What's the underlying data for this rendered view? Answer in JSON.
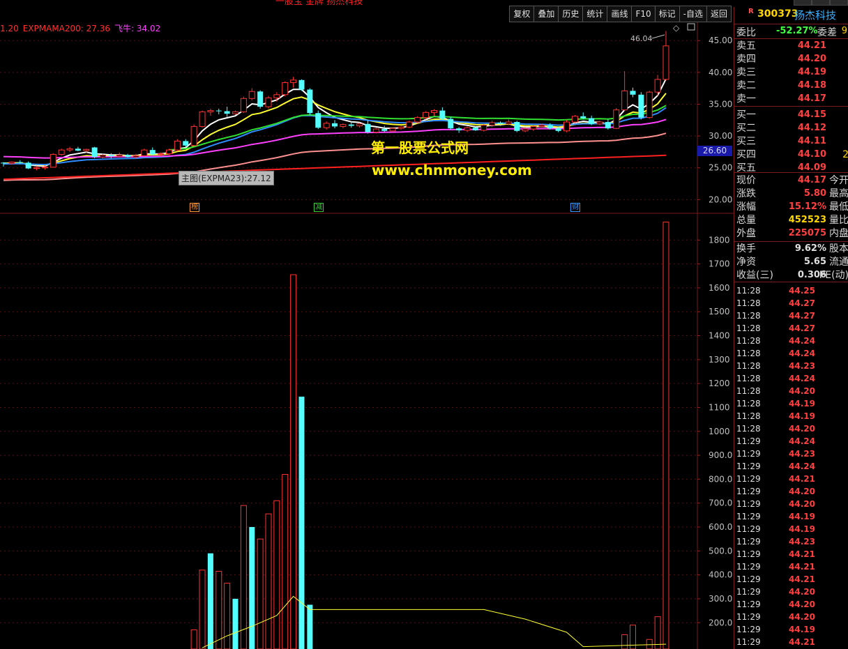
{
  "window": {
    "title": "一股宝 金牌 扬杰科技",
    "toolbar": [
      "复权",
      "叠加",
      "历史",
      "统计",
      "画线",
      "F10",
      "标记",
      "-自选",
      "返回"
    ]
  },
  "indicator_bar": {
    "items": [
      {
        "text": "1.20",
        "color": "#ff3030"
      },
      {
        "text": "EXPMAMA200: 27.36",
        "color": "#ff3030"
      },
      {
        "text": "飞牛: 34.02",
        "color": "#ff40ff"
      }
    ]
  },
  "watermark": {
    "line1": "第一股票公式网",
    "line2": "www.chnmoney.com"
  },
  "tooltip": "主图(EXPMA23):27.12",
  "price_badge": "26.60",
  "high_label": "46.04",
  "markers": [
    {
      "text": "榜",
      "color": "#ff9933"
    },
    {
      "text": "减",
      "color": "#33cc33"
    },
    {
      "text": "财",
      "color": "#3399ff"
    }
  ],
  "chart_data": [
    {
      "type": "candlestick",
      "title": "",
      "ylim": [
        18.5,
        47
      ],
      "y_ticks": [
        "45.00",
        "40.00",
        "35.00",
        "30.00",
        "25.00",
        "20.00"
      ],
      "y_tick_values": [
        45,
        40,
        35,
        30,
        25,
        20
      ],
      "candles": [
        [
          25.8,
          25.9,
          25.2,
          25.7
        ],
        [
          25.7,
          26.0,
          25.5,
          25.9
        ],
        [
          25.9,
          26.2,
          25.6,
          25.8
        ],
        [
          25.8,
          26.0,
          24.8,
          24.9
        ],
        [
          24.9,
          25.3,
          24.6,
          25.0
        ],
        [
          25.0,
          25.4,
          24.7,
          25.1
        ],
        [
          25.1,
          27.3,
          25.0,
          27.1
        ],
        [
          27.1,
          28.0,
          26.9,
          27.8
        ],
        [
          27.8,
          28.3,
          27.5,
          28.0
        ],
        [
          28.0,
          28.3,
          27.6,
          27.7
        ],
        [
          27.7,
          28.0,
          27.3,
          27.9
        ],
        [
          28.2,
          28.3,
          26.5,
          26.7
        ],
        [
          26.7,
          27.2,
          26.5,
          27.0
        ],
        [
          27.0,
          27.3,
          26.5,
          26.8
        ],
        [
          26.8,
          27.4,
          26.6,
          27.0
        ],
        [
          27.0,
          27.2,
          26.6,
          26.7
        ],
        [
          26.7,
          27.2,
          26.4,
          26.9
        ],
        [
          26.9,
          28.0,
          26.8,
          27.8
        ],
        [
          27.8,
          28.2,
          27.0,
          27.1
        ],
        [
          27.1,
          27.4,
          26.8,
          27.2
        ],
        [
          27.2,
          28.0,
          27.0,
          27.8
        ],
        [
          27.8,
          29.5,
          27.6,
          29.2
        ],
        [
          29.2,
          29.5,
          28.3,
          28.5
        ],
        [
          28.5,
          31.8,
          28.4,
          31.5
        ],
        [
          31.5,
          34.0,
          31.3,
          33.8
        ],
        [
          33.8,
          34.3,
          33.2,
          34.0
        ],
        [
          34.0,
          34.3,
          33.4,
          33.9
        ],
        [
          33.9,
          34.6,
          33.0,
          33.5
        ],
        [
          33.5,
          34.0,
          33.3,
          33.8
        ],
        [
          33.8,
          36.2,
          33.6,
          35.9
        ],
        [
          35.9,
          37.5,
          35.6,
          37.0
        ],
        [
          37.0,
          37.2,
          34.3,
          34.6
        ],
        [
          34.6,
          36.3,
          34.3,
          36.0
        ],
        [
          36.0,
          36.9,
          35.4,
          36.5
        ],
        [
          36.5,
          38.6,
          36.2,
          38.4
        ],
        [
          38.4,
          39.3,
          37.6,
          38.8
        ],
        [
          38.8,
          38.9,
          37.1,
          37.3
        ],
        [
          37.3,
          37.5,
          33.3,
          33.6
        ],
        [
          33.6,
          34.0,
          31.1,
          31.3
        ],
        [
          31.3,
          32.3,
          31.0,
          32.0
        ],
        [
          32.0,
          32.5,
          31.2,
          31.5
        ],
        [
          31.5,
          32.0,
          31.2,
          31.8
        ],
        [
          31.8,
          32.3,
          31.3,
          31.6
        ],
        [
          31.6,
          32.1,
          31.3,
          31.9
        ],
        [
          31.9,
          32.5,
          30.4,
          30.6
        ],
        [
          30.6,
          31.3,
          30.4,
          31.1
        ],
        [
          31.1,
          31.6,
          30.6,
          30.8
        ],
        [
          30.8,
          31.4,
          30.6,
          31.2
        ],
        [
          31.2,
          31.6,
          31.0,
          31.4
        ],
        [
          31.4,
          32.4,
          31.2,
          32.2
        ],
        [
          32.2,
          33.1,
          32.0,
          32.9
        ],
        [
          32.9,
          33.9,
          32.6,
          33.7
        ],
        [
          33.7,
          34.2,
          33.2,
          34.0
        ],
        [
          34.0,
          34.5,
          32.5,
          32.7
        ],
        [
          32.7,
          33.0,
          31.0,
          31.2
        ],
        [
          31.2,
          31.4,
          30.5,
          30.9
        ],
        [
          30.9,
          31.5,
          30.6,
          31.3
        ],
        [
          31.3,
          31.5,
          30.8,
          30.9
        ],
        [
          30.9,
          31.9,
          30.7,
          31.7
        ],
        [
          31.7,
          32.4,
          31.4,
          32.1
        ],
        [
          32.1,
          32.3,
          31.6,
          31.9
        ],
        [
          31.9,
          32.6,
          31.7,
          32.2
        ],
        [
          32.2,
          32.4,
          30.6,
          30.8
        ],
        [
          30.8,
          31.4,
          30.6,
          31.1
        ],
        [
          31.1,
          31.6,
          30.8,
          31.5
        ],
        [
          31.5,
          31.9,
          31.3,
          31.7
        ],
        [
          31.7,
          32.0,
          31.0,
          31.2
        ],
        [
          31.2,
          31.4,
          30.6,
          30.8
        ],
        [
          30.8,
          32.5,
          30.6,
          32.2
        ],
        [
          32.2,
          33.3,
          32.0,
          33.1
        ],
        [
          33.1,
          33.7,
          32.6,
          32.8
        ],
        [
          32.8,
          33.2,
          31.7,
          31.9
        ],
        [
          31.9,
          32.4,
          31.7,
          32.2
        ],
        [
          32.2,
          32.6,
          31.0,
          31.2
        ],
        [
          31.2,
          34.4,
          31.1,
          34.1
        ],
        [
          34.1,
          40.2,
          33.9,
          37.1
        ],
        [
          37.1,
          37.6,
          36.1,
          36.5
        ],
        [
          36.5,
          36.9,
          32.6,
          32.9
        ],
        [
          32.9,
          37.1,
          32.7,
          36.9
        ],
        [
          36.9,
          39.6,
          36.3,
          38.9
        ],
        [
          38.9,
          46.5,
          38.7,
          44.17
        ]
      ],
      "ma_lines": [
        {
          "name": "",
          "color": "#ffffff",
          "values": []
        },
        {
          "name": "",
          "color": "#ffff30",
          "values": []
        },
        {
          "name": "",
          "color": "#2f8cff",
          "values": []
        },
        {
          "name": "",
          "color": "#ff40ff",
          "values": []
        },
        {
          "name": "",
          "color": "#30e030",
          "values": []
        },
        {
          "name": "",
          "color": "#ff9090",
          "values": []
        },
        {
          "name": "",
          "color": "#ff2020",
          "values": []
        }
      ]
    },
    {
      "type": "bar",
      "title": "",
      "ylim": [
        90,
        1900
      ],
      "y_ticks": [
        "1800",
        "1700",
        "1600",
        "1500",
        "1400",
        "1300",
        "1200",
        "1100",
        "1000",
        "900.0",
        "800.0",
        "700.0",
        "600.0",
        "500.0",
        "400.0",
        "300.0",
        "200.0"
      ],
      "y_tick_values": [
        1800,
        1700,
        1600,
        1500,
        1400,
        1300,
        1200,
        1100,
        1000,
        900,
        800,
        700,
        600,
        500,
        400,
        300,
        200
      ],
      "bars": [
        {
          "i": 23,
          "value": 170,
          "up": true
        },
        {
          "i": 24,
          "value": 420,
          "up": true
        },
        {
          "i": 25,
          "value": 490,
          "up": false
        },
        {
          "i": 26,
          "value": 415,
          "up": true
        },
        {
          "i": 27,
          "value": 365,
          "up": true
        },
        {
          "i": 28,
          "value": 300,
          "up": false
        },
        {
          "i": 29,
          "value": 690,
          "up": true
        },
        {
          "i": 30,
          "value": 600,
          "up": false
        },
        {
          "i": 31,
          "value": 550,
          "up": true
        },
        {
          "i": 32,
          "value": 655,
          "up": true
        },
        {
          "i": 33,
          "value": 710,
          "up": true
        },
        {
          "i": 34,
          "value": 820,
          "up": true
        },
        {
          "i": 35,
          "value": 1655,
          "up": true
        },
        {
          "i": 36,
          "value": 1145,
          "up": false
        },
        {
          "i": 37,
          "value": 275,
          "up": false
        },
        {
          "i": 75,
          "value": 150,
          "up": true
        },
        {
          "i": 76,
          "value": 190,
          "up": true
        },
        {
          "i": 78,
          "value": 130,
          "up": true
        },
        {
          "i": 79,
          "value": 225,
          "up": true
        },
        {
          "i": 80,
          "value": 1875,
          "up": true
        }
      ],
      "avg_line": {
        "color": "#ffff30",
        "points": [
          [
            24,
            95
          ],
          [
            27,
            145
          ],
          [
            30,
            185
          ],
          [
            33,
            230
          ],
          [
            35,
            310
          ],
          [
            37,
            255
          ],
          [
            58,
            255
          ],
          [
            63,
            215
          ],
          [
            68,
            160
          ],
          [
            70,
            100
          ],
          [
            80,
            110
          ]
        ]
      }
    }
  ],
  "quote_panel": {
    "rmark": "R",
    "code": "300373",
    "name": "扬杰科技",
    "weibi_label": "委比",
    "weibi_value": "-52.27%",
    "weicha_label": "委差",
    "weicha_value": "9",
    "order_book": [
      {
        "label": "卖五",
        "price": "44.21",
        "extra": ""
      },
      {
        "label": "卖四",
        "price": "44.20",
        "extra": ""
      },
      {
        "label": "卖三",
        "price": "44.19",
        "extra": ""
      },
      {
        "label": "卖二",
        "price": "44.18",
        "extra": ""
      },
      {
        "label": "卖一",
        "price": "44.17",
        "extra": ""
      },
      {
        "label": "买一",
        "price": "44.15",
        "extra": ""
      },
      {
        "label": "买二",
        "price": "44.12",
        "extra": ""
      },
      {
        "label": "买三",
        "price": "44.11",
        "extra": ""
      },
      {
        "label": "买四",
        "price": "44.10",
        "extra": "2"
      },
      {
        "label": "买五",
        "price": "44.09",
        "extra": ""
      }
    ],
    "stats": [
      {
        "label": "现价",
        "value": "44.17",
        "color": "#ff4040",
        "extra": "今开"
      },
      {
        "label": "涨跌",
        "value": "5.80",
        "color": "#ff4040",
        "extra": "最高"
      },
      {
        "label": "涨幅",
        "value": "15.12%",
        "color": "#ff4040",
        "extra": "最低"
      },
      {
        "label": "总量",
        "value": "452523",
        "color": "#ffd700",
        "extra": "量比"
      },
      {
        "label": "外盘",
        "value": "225075",
        "color": "#ff4040",
        "extra": "内盘"
      }
    ],
    "stats2": [
      {
        "label": "换手",
        "value": "9.62%",
        "color": "#e0e0e0",
        "extra": "股本"
      },
      {
        "label": "净资",
        "value": "5.65",
        "color": "#e0e0e0",
        "extra": "流通"
      },
      {
        "label": "收益(三)",
        "value": "0.306",
        "color": "#e0e0e0",
        "extra": "PE(动)"
      }
    ],
    "ticks": [
      {
        "t": "11:28",
        "p": "44.25"
      },
      {
        "t": "11:28",
        "p": "44.27"
      },
      {
        "t": "11:28",
        "p": "44.27"
      },
      {
        "t": "11:28",
        "p": "44.27"
      },
      {
        "t": "11:28",
        "p": "44.24"
      },
      {
        "t": "11:28",
        "p": "44.24"
      },
      {
        "t": "11:28",
        "p": "44.23"
      },
      {
        "t": "11:28",
        "p": "44.24"
      },
      {
        "t": "11:28",
        "p": "44.20"
      },
      {
        "t": "11:28",
        "p": "44.19"
      },
      {
        "t": "11:28",
        "p": "44.19"
      },
      {
        "t": "11:28",
        "p": "44.20"
      },
      {
        "t": "11:29",
        "p": "44.24"
      },
      {
        "t": "11:29",
        "p": "44.23"
      },
      {
        "t": "11:29",
        "p": "44.24"
      },
      {
        "t": "11:29",
        "p": "44.21"
      },
      {
        "t": "11:29",
        "p": "44.20"
      },
      {
        "t": "11:29",
        "p": "44.20"
      },
      {
        "t": "11:29",
        "p": "44.19"
      },
      {
        "t": "11:29",
        "p": "44.19"
      },
      {
        "t": "11:29",
        "p": "44.23"
      },
      {
        "t": "11:29",
        "p": "44.21"
      },
      {
        "t": "11:29",
        "p": "44.21"
      },
      {
        "t": "11:29",
        "p": "44.21"
      },
      {
        "t": "11:29",
        "p": "44.20"
      },
      {
        "t": "11:29",
        "p": "44.20"
      },
      {
        "t": "11:29",
        "p": "44.20"
      },
      {
        "t": "11:29",
        "p": "44.19"
      },
      {
        "t": "11:29",
        "p": "44.21"
      }
    ]
  }
}
